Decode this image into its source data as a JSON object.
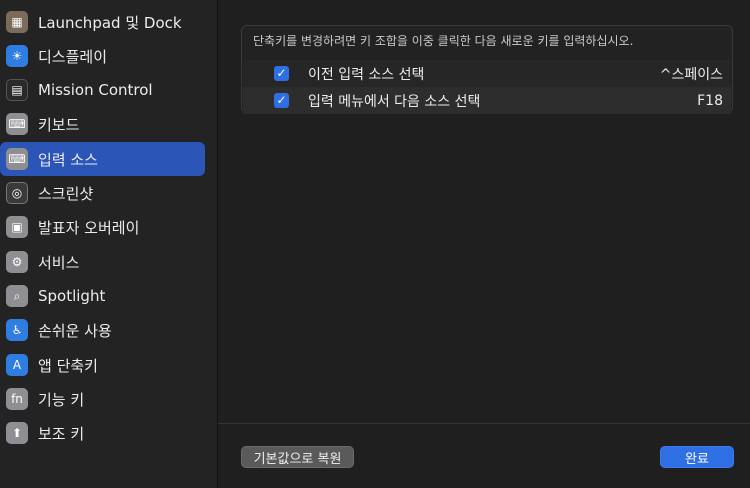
{
  "sidebar": {
    "items": [
      {
        "label": "Launchpad 및 Dock",
        "icon": "launchpad-icon",
        "color": "#7b6b5a",
        "glyph": "▦"
      },
      {
        "label": "디스플레이",
        "icon": "display-sun-icon",
        "color": "#2f7de1",
        "glyph": "☀"
      },
      {
        "label": "Mission Control",
        "icon": "mission-control-icon",
        "color": "#2a2a2a",
        "glyph": "▤"
      },
      {
        "label": "키보드",
        "icon": "keyboard-icon",
        "color": "#8e8e93",
        "glyph": "⌨"
      },
      {
        "label": "입력 소스",
        "icon": "input-source-icon",
        "color": "#8e8e93",
        "glyph": "⌨"
      },
      {
        "label": "스크린샷",
        "icon": "screenshot-icon",
        "color": "#3a3a3a",
        "glyph": "◎"
      },
      {
        "label": "발표자 오버레이",
        "icon": "presenter-overlay-icon",
        "color": "#8e8e93",
        "glyph": "▣"
      },
      {
        "label": "서비스",
        "icon": "services-gear-icon",
        "color": "#8e8e93",
        "glyph": "⚙"
      },
      {
        "label": "Spotlight",
        "icon": "spotlight-search-icon",
        "color": "#8e8e93",
        "glyph": "⌕"
      },
      {
        "label": "손쉬운 사용",
        "icon": "accessibility-icon",
        "color": "#2f7de1",
        "glyph": "♿"
      },
      {
        "label": "앱 단축키",
        "icon": "app-shortcuts-icon",
        "color": "#2f7de1",
        "glyph": "A"
      },
      {
        "label": "기능 키",
        "icon": "function-key-icon",
        "color": "#8e8e93",
        "glyph": "fn"
      },
      {
        "label": "보조 키",
        "icon": "modifier-key-icon",
        "color": "#8e8e93",
        "glyph": "⬆"
      }
    ]
  },
  "main": {
    "instruction": "단축키를 변경하려면 키 조합을 이중 클릭한 다음 새로운 키를 입력하십시오.",
    "shortcuts": [
      {
        "label": "이전 입력 소스 선택",
        "key": "^스페이스",
        "checked": true
      },
      {
        "label": "입력 메뉴에서 다음 소스 선택",
        "key": "F18",
        "checked": true
      }
    ],
    "checkmark": "✓"
  },
  "footer": {
    "reset_label": "기본값으로 복원",
    "done_label": "완료"
  },
  "colors": {
    "accent": "#2f6fe4",
    "selected_sidebar": "#2c55b8"
  }
}
